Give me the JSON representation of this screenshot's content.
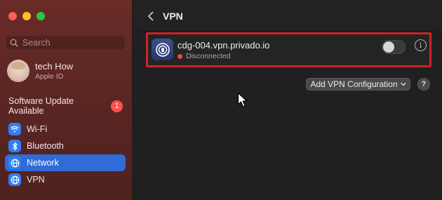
{
  "window": {
    "traffic_lights": [
      "close",
      "minimize",
      "zoom"
    ]
  },
  "sidebar": {
    "search": {
      "placeholder": "Search",
      "value": ""
    },
    "account": {
      "name": "tech How",
      "subtitle": "Apple ID"
    },
    "update": {
      "label": "Software Update Available",
      "badge": "1"
    },
    "items": [
      {
        "label": "Wi-Fi",
        "icon": "wifi-icon",
        "active": false
      },
      {
        "label": "Bluetooth",
        "icon": "bluetooth-icon",
        "active": false
      },
      {
        "label": "Network",
        "icon": "globe-icon",
        "active": true
      },
      {
        "label": "VPN",
        "icon": "globe-icon",
        "active": false
      }
    ]
  },
  "main": {
    "title": "VPN",
    "vpn": {
      "name": "cdg-004.vpn.privado.io",
      "status": "Disconnected",
      "status_color": "#e74c3c",
      "enabled": false
    },
    "add_button": "Add VPN Configuration",
    "help": "?"
  },
  "colors": {
    "accent": "#2f6cd6",
    "highlight_border": "#d0212b",
    "badge": "#ff4f4f"
  }
}
